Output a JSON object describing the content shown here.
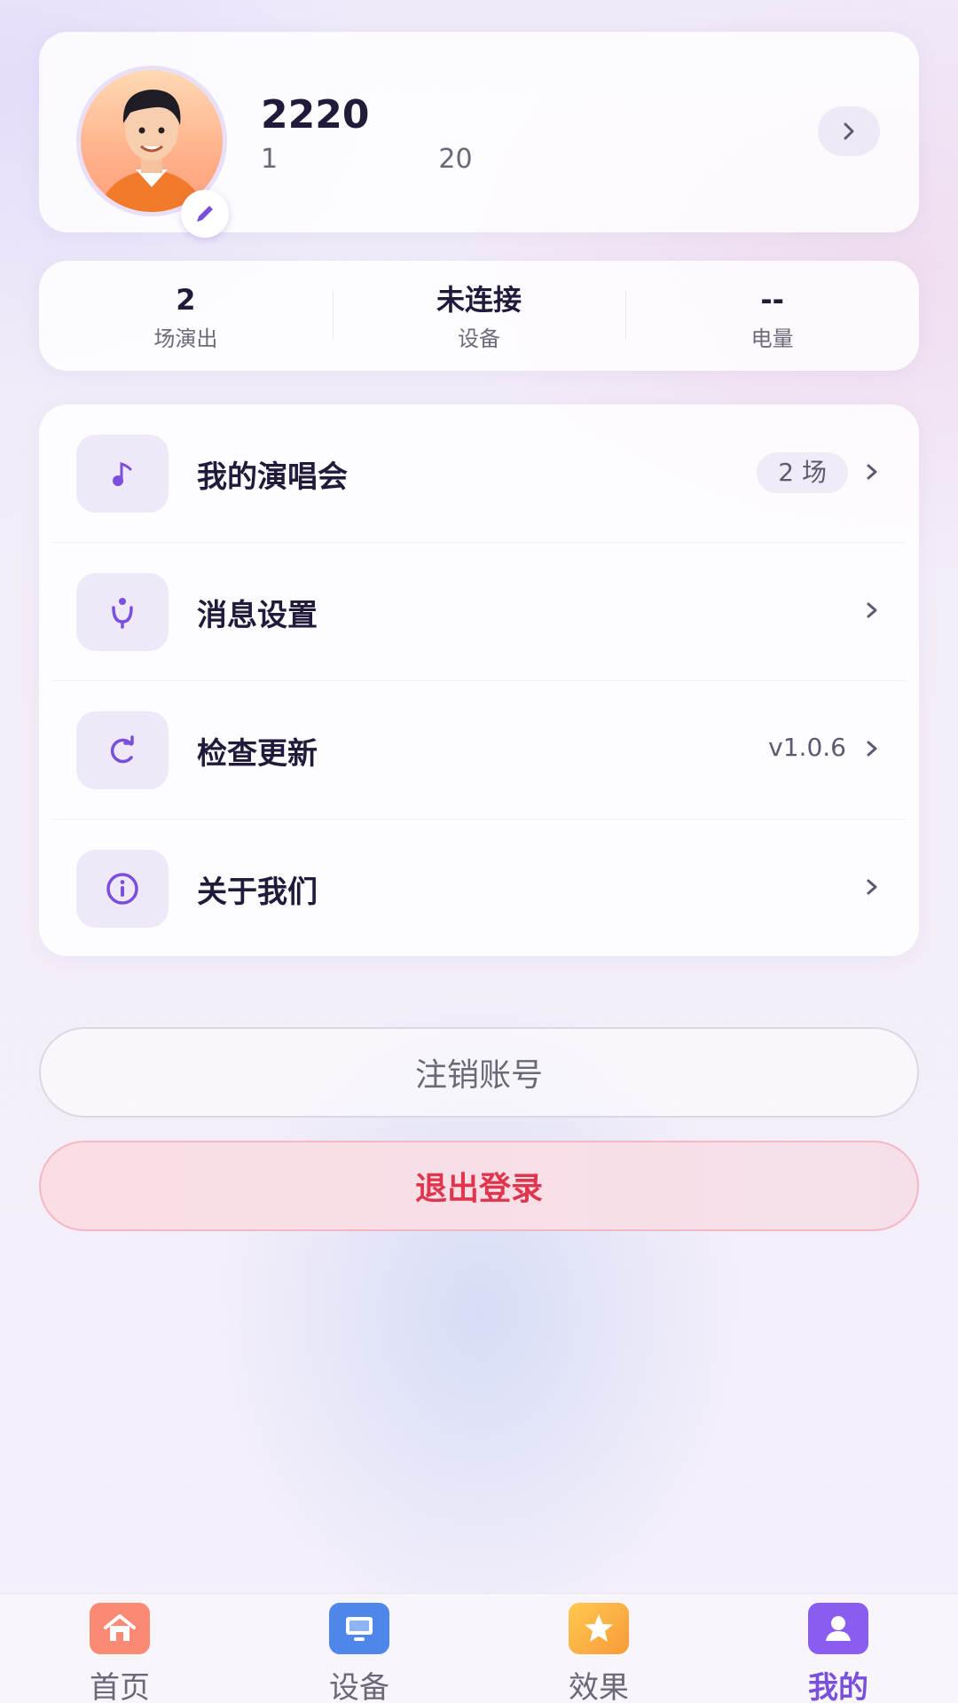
{
  "profile": {
    "name": "2220",
    "user_id": "1          20"
  },
  "stats": [
    {
      "value": "2",
      "label": "场演出"
    },
    {
      "value": "未连接",
      "label": "设备"
    },
    {
      "value": "--",
      "label": "电量"
    }
  ],
  "menu": {
    "concerts": {
      "label": "我的演唱会",
      "badge": "2 场",
      "icon": "music-note-icon"
    },
    "notifications": {
      "label": "消息设置",
      "icon": "notification-settings-icon"
    },
    "update": {
      "label": "检查更新",
      "version": "v1.0.6",
      "icon": "refresh-icon"
    },
    "about": {
      "label": "关于我们",
      "icon": "info-icon"
    }
  },
  "buttons": {
    "deactivate": "注销账号",
    "logout": "退出登录"
  },
  "tabs": [
    {
      "label": "首页",
      "icon": "home-icon",
      "color": "#fb8a74"
    },
    {
      "label": "设备",
      "icon": "device-icon",
      "color": "#4f86ea"
    },
    {
      "label": "效果",
      "icon": "star-icon",
      "color": "#fbb44a"
    },
    {
      "label": "我的",
      "icon": "profile-icon",
      "color": "#8a5cf0",
      "active": true
    }
  ],
  "colors": {
    "accent": "#7a4fdc",
    "danger": "#e0364d"
  }
}
